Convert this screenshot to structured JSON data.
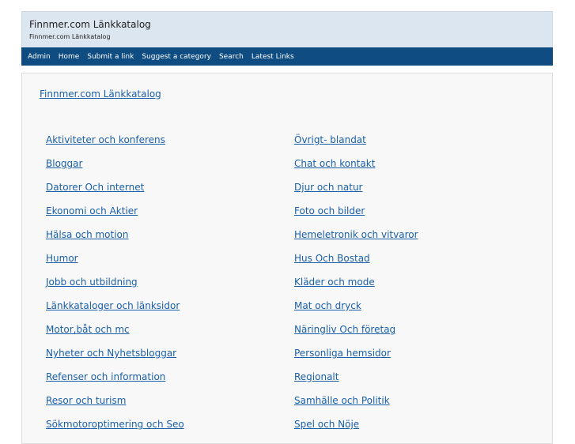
{
  "header": {
    "title": "Finnmer.com Länkkatalog",
    "subtitle": "Finnmer.com Länkkatalog"
  },
  "nav": {
    "items": [
      "Admin",
      "Home",
      "Submit a link",
      "Suggest a category",
      "Search",
      "Latest Links"
    ]
  },
  "breadcrumb": "Finnmer.com Länkkatalog",
  "categories": {
    "left": [
      "Aktiviteter och konferens",
      "Bloggar",
      "Datorer Och internet",
      "Ekonomi och Aktier",
      "Hälsa och motion",
      "Humor",
      "Jobb och utbildning",
      "Länkkataloger och länksidor",
      "Motor,båt och mc",
      "Nyheter och Nyhetsbloggar",
      "Refenser och information",
      "Resor och turism",
      "Sökmotoroptimering och Seo"
    ],
    "right": [
      "Övrigt- blandat",
      "Chat och kontakt",
      "Djur och natur",
      "Foto och bilder",
      "Hemeletronik och vitvaror",
      "Hus Och Bostad",
      "Kläder och mode",
      "Mat och dryck",
      "Näringliv Och företag",
      "Personliga hemsidor",
      "Regionalt",
      "Samhälle och Politik",
      "Spel och Nöje"
    ]
  }
}
